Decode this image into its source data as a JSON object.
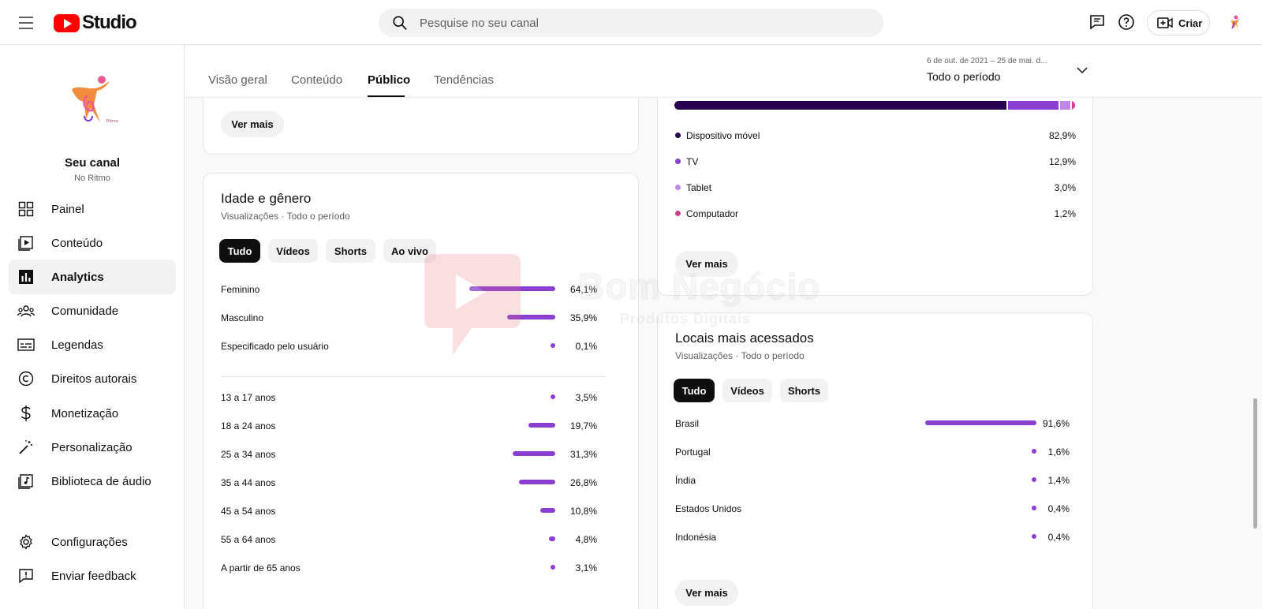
{
  "header": {
    "logo_text": "Studio",
    "search_placeholder": "Pesquise no seu canal",
    "create_label": "Criar"
  },
  "sidebar": {
    "channel_name": "Seu canal",
    "channel_subtitle": "No Ritmo",
    "items": [
      {
        "label": "Painel",
        "icon": "dashboard-icon"
      },
      {
        "label": "Conteúdo",
        "icon": "content-icon"
      },
      {
        "label": "Analytics",
        "icon": "analytics-icon",
        "active": true
      },
      {
        "label": "Comunidade",
        "icon": "community-icon"
      },
      {
        "label": "Legendas",
        "icon": "subtitles-icon"
      },
      {
        "label": "Direitos autorais",
        "icon": "copyright-icon"
      },
      {
        "label": "Monetização",
        "icon": "dollar-icon"
      },
      {
        "label": "Personalização",
        "icon": "magic-wand-icon"
      },
      {
        "label": "Biblioteca de áudio",
        "icon": "audio-library-icon"
      }
    ],
    "bottom_items": [
      {
        "label": "Configurações",
        "icon": "gear-icon"
      },
      {
        "label": "Enviar feedback",
        "icon": "feedback-icon"
      }
    ]
  },
  "tabs": [
    {
      "label": "Visão geral"
    },
    {
      "label": "Conteúdo"
    },
    {
      "label": "Público",
      "active": true
    },
    {
      "label": "Tendências"
    }
  ],
  "period": {
    "range": "6 de out. de 2021 – 25 de mai. d...",
    "label": "Todo o período"
  },
  "top_card": {
    "see_more": "Ver mais"
  },
  "age_gender": {
    "title": "Idade e gênero",
    "subtitle": "Visualizações · Todo o período",
    "filters": [
      "Tudo",
      "Vídeos",
      "Shorts",
      "Ao vivo"
    ],
    "selected_filter": "Tudo",
    "gender": [
      {
        "label": "Feminino",
        "value": "64,1%",
        "pct": 64.1
      },
      {
        "label": "Masculino",
        "value": "35,9%",
        "pct": 35.9
      },
      {
        "label": "Especificado pelo usuário",
        "value": "0,1%",
        "pct": 0.1
      }
    ],
    "ages": [
      {
        "label": "13 a 17 anos",
        "value": "3,5%",
        "pct": 3.5
      },
      {
        "label": "18 a 24 anos",
        "value": "19,7%",
        "pct": 19.7
      },
      {
        "label": "25 a 34 anos",
        "value": "31,3%",
        "pct": 31.3
      },
      {
        "label": "35 a 44 anos",
        "value": "26,8%",
        "pct": 26.8
      },
      {
        "label": "45 a 54 anos",
        "value": "10,8%",
        "pct": 10.8
      },
      {
        "label": "55 a 64 anos",
        "value": "4,8%",
        "pct": 4.8
      },
      {
        "label": "A partir de 65 anos",
        "value": "3,1%",
        "pct": 3.1
      }
    ]
  },
  "devices": {
    "items": [
      {
        "label": "Dispositivo móvel",
        "value": "82,9%",
        "pct": 82.9,
        "color": "#28004f"
      },
      {
        "label": "TV",
        "value": "12,9%",
        "pct": 12.9,
        "color": "#8a3fd0"
      },
      {
        "label": "Tablet",
        "value": "3,0%",
        "pct": 3.0,
        "color": "#c187e8"
      },
      {
        "label": "Computador",
        "value": "1,2%",
        "pct": 1.2,
        "color": "#d13f8a"
      }
    ],
    "see_more": "Ver mais"
  },
  "locations": {
    "title": "Locais mais acessados",
    "subtitle": "Visualizações · Todo o período",
    "filters": [
      "Tudo",
      "Vídeos",
      "Shorts"
    ],
    "selected_filter": "Tudo",
    "items": [
      {
        "label": "Brasil",
        "value": "91,6%",
        "pct": 91.6
      },
      {
        "label": "Portugal",
        "value": "1,6%",
        "pct": 1.6
      },
      {
        "label": "Índia",
        "value": "1,4%",
        "pct": 1.4
      },
      {
        "label": "Estados Unidos",
        "value": "0,4%",
        "pct": 0.4
      },
      {
        "label": "Indonésia",
        "value": "0,4%",
        "pct": 0.4
      }
    ],
    "see_more": "Ver mais"
  },
  "watermark": {
    "title": "Bom Negócio",
    "subtitle": "Produtos Digitais"
  },
  "colors": {
    "bar": "#8a3fd0",
    "accent_red": "#ff0000"
  }
}
